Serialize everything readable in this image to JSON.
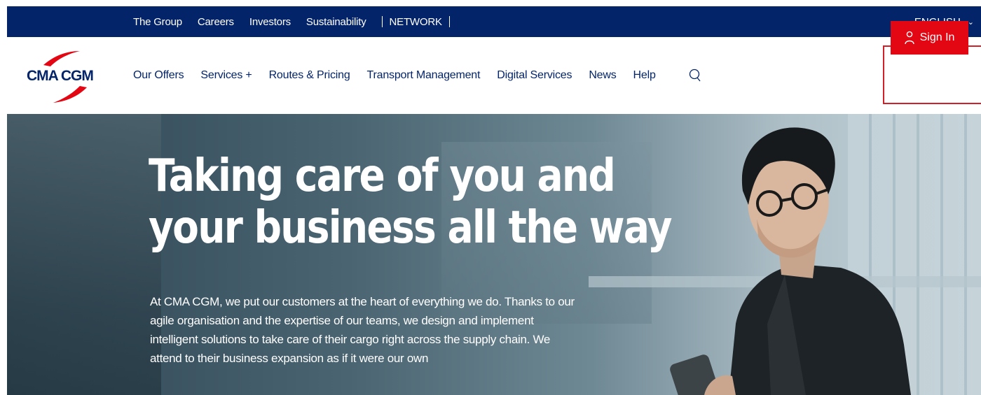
{
  "topbar": {
    "links": [
      "The Group",
      "Careers",
      "Investors",
      "Sustainability"
    ],
    "network": "NETWORK",
    "language": "ENGLISH"
  },
  "logo": {
    "text": "CMA CGM",
    "colors": {
      "navy": "#04246a",
      "red": "#e30613"
    }
  },
  "nav": {
    "items": [
      "Our Offers",
      "Services +",
      "Routes & Pricing",
      "Transport Management",
      "Digital Services",
      "News",
      "Help"
    ],
    "search_icon": "search-icon",
    "sign_in": "Sign In"
  },
  "hero": {
    "headline_line1": "Taking care of you and",
    "headline_line2": "your business all the way",
    "body": "At CMA CGM, we put our customers at the heart of everything we do. Thanks to our agile organisation and the expertise of our teams, we design and implement intelligent solutions to take care of their cargo right across the supply chain. We attend to their business expansion as if it were our own"
  },
  "colors": {
    "topbar_bg": "#04246a",
    "nav_text": "#04246a",
    "accent_red": "#e30613",
    "highlight_border": "#d1202a"
  }
}
